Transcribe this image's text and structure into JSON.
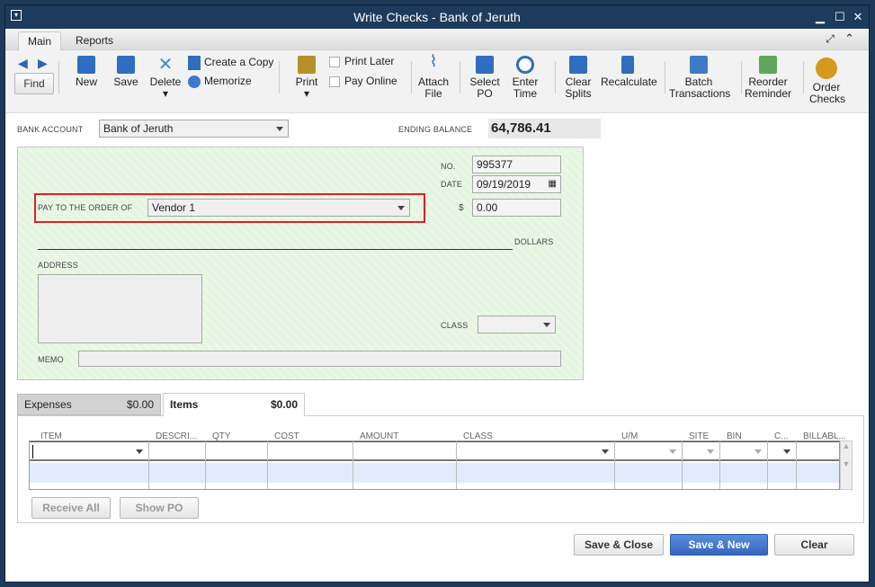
{
  "window": {
    "title": "Write Checks - Bank of Jeruth"
  },
  "ribbon_tabs": [
    "Main",
    "Reports"
  ],
  "toolbar": {
    "find": "Find",
    "new": "New",
    "save": "Save",
    "delete": "Delete",
    "create_copy": "Create a Copy",
    "memorize": "Memorize",
    "print": "Print",
    "print_later": "Print Later",
    "pay_online": "Pay Online",
    "attach_file": "Attach File",
    "select_po": "Select PO",
    "enter_time": "Enter Time",
    "clear_splits": "Clear Splits",
    "recalculate": "Recalculate",
    "batch_transactions": "Batch Transactions",
    "reorder_reminder": "Reorder Reminder",
    "order_checks": "Order Checks"
  },
  "form": {
    "bank_account_label": "BANK ACCOUNT",
    "bank_account": "Bank of Jeruth",
    "ending_balance_label": "ENDING BALANCE",
    "ending_balance": "64,786.41"
  },
  "check": {
    "no_label": "NO.",
    "no": "995377",
    "date_label": "DATE",
    "date": "09/19/2019",
    "pay_to_label": "PAY TO THE ORDER OF",
    "pay_to": "Vendor 1",
    "amount_label": "$",
    "amount": "0.00",
    "dollars_label": "DOLLARS",
    "address_label": "ADDRESS",
    "class_label": "CLASS",
    "memo_label": "MEMO"
  },
  "detail_tabs": [
    {
      "label": "Expenses",
      "amount": "$0.00"
    },
    {
      "label": "Items",
      "amount": "$0.00"
    }
  ],
  "table": {
    "columns": [
      "ITEM",
      "DESCRI...",
      "QTY",
      "COST",
      "AMOUNT",
      "CLASS",
      "U/M",
      "SITE",
      "BIN",
      "C...",
      "BILLABL..."
    ]
  },
  "detail_buttons": {
    "receive_all": "Receive All",
    "show_po": "Show PO"
  },
  "footer": {
    "save_close": "Save & Close",
    "save_new": "Save & New",
    "clear": "Clear"
  },
  "colors": {
    "titlebar": "#1d3b5c",
    "check_bg": "#e4f5e0",
    "highlight": "#e0201c",
    "primary": "#3f74c9"
  }
}
